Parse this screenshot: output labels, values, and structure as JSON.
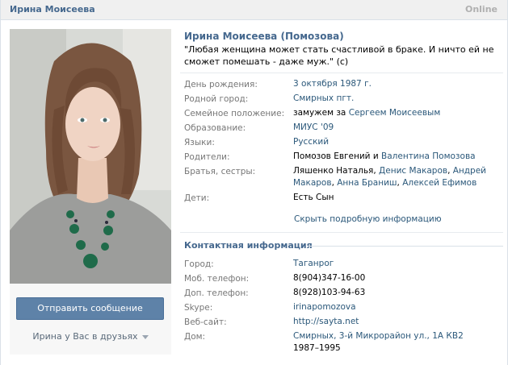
{
  "header": {
    "name": "Ирина Моисеева",
    "online": "Online"
  },
  "left": {
    "send_message": "Отправить сообщение",
    "friends_status": "Ирина у Вас в друзьях"
  },
  "profile": {
    "full_name": "Ирина Моисеева (Помозова)",
    "status": "\"Любая женщина может стать счастливой в браке. И ничто ей не сможет помешать - даже муж.\" (с)"
  },
  "info": {
    "birthday_label": "День рождения:",
    "birthday_value": "3 октября 1987 г.",
    "hometown_label": "Родной город:",
    "hometown_value": "Смирных пгт.",
    "relationship_label": "Семейное положение:",
    "relationship_prefix": "замужем за ",
    "relationship_person": "Сергеем Моисеевым",
    "education_label": "Образование:",
    "education_value": "МИУС '09",
    "languages_label": "Языки:",
    "languages_value": "Русский",
    "parents_label": "Родители:",
    "parent_1": "Помозов Евгений",
    "parents_and": " и ",
    "parent_2": "Валентина Помозова",
    "siblings_label": "Братья, сестры:",
    "siblings": [
      "Ляшенко Наталья",
      "Денис Макаров",
      "Андрей Макаров",
      "Анна Браниш",
      "Алексей Ефимов"
    ],
    "children_label": "Дети:",
    "children_value": "Есть Сын",
    "more_link": "Скрыть подробную информацию"
  },
  "contacts": {
    "title": "Контактная информация",
    "city_label": "Город:",
    "city_value": "Таганрог",
    "mobile_label": "Моб. телефон:",
    "mobile_value": "8(904)347-16-00",
    "extra_phone_label": "Доп. телефон:",
    "extra_phone_value": "8(928)103-94-63",
    "skype_label": "Skype:",
    "skype_value": "irinapomozova",
    "website_label": "Веб-сайт:",
    "website_value": "http://sayta.net",
    "home_label": "Дом:",
    "home_value": "Смирных, 3-й Микрорайон ул., 1А КВ2",
    "home_years": "1987–1995"
  }
}
